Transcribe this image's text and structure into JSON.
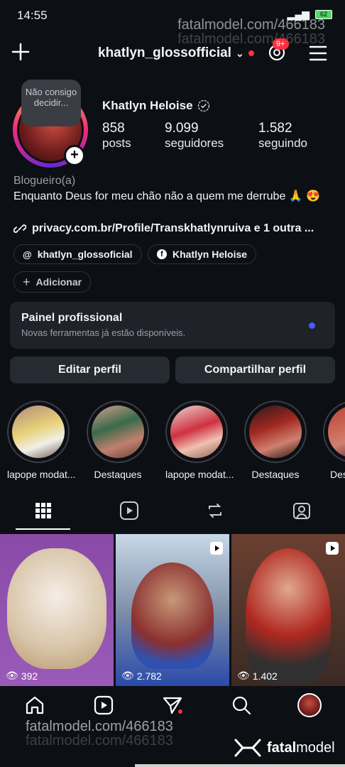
{
  "status_bar": {
    "time": "14:55",
    "battery": "62"
  },
  "watermark": {
    "text": "fatalmodel.com/466183",
    "brand": "fatal",
    "brand2": "model"
  },
  "header": {
    "username": "khatlyn_glossofficial",
    "notif_badge": "9+"
  },
  "profile": {
    "note": "Não consigo decidir...",
    "display_name": "Khatlyn Heloise",
    "stats": [
      {
        "value": "858",
        "label": "posts"
      },
      {
        "value": "9.099",
        "label": "seguidores"
      },
      {
        "value": "1.582",
        "label": "seguindo"
      }
    ],
    "category": "Blogueiro(a)",
    "bio": "Enquanto Deus for meu chão não a quem me derrube 🙏 😍",
    "link": "privacy.com.br/Profile/Transkhatlynruiva e 1 outra ...",
    "chips": [
      "khatlyn_glossoficial",
      "Khatlyn Heloise"
    ],
    "add_label": "Adicionar"
  },
  "panel": {
    "title": "Painel profissional",
    "subtitle": "Novas ferramentas já estão disponíveis."
  },
  "buttons": {
    "edit": "Editar perfil",
    "share": "Compartilhar perfil"
  },
  "highlights": [
    {
      "label": "lapope modat..."
    },
    {
      "label": "Destaques"
    },
    {
      "label": "lapope modat..."
    },
    {
      "label": "Destaques"
    },
    {
      "label": "Des"
    }
  ],
  "posts": [
    {
      "views": "392"
    },
    {
      "views": "2.782"
    },
    {
      "views": "1.402"
    }
  ],
  "colors": {
    "background": "#0c0f14",
    "accent_red": "#ff3040",
    "panel": "#1f2229"
  }
}
